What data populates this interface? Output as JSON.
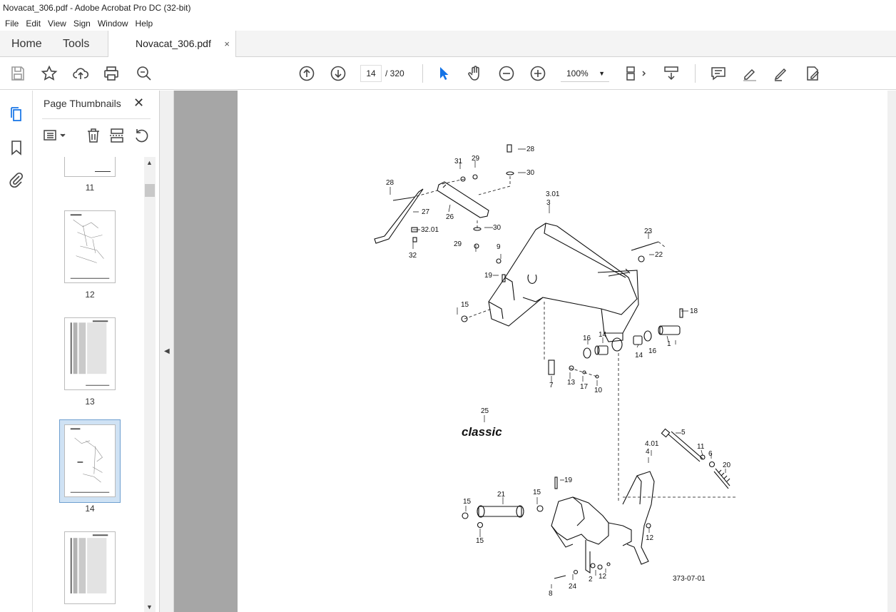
{
  "window": {
    "title": "Novacat_306.pdf - Adobe Acrobat Pro DC (32-bit)"
  },
  "menu": [
    "File",
    "Edit",
    "View",
    "Sign",
    "Window",
    "Help"
  ],
  "tabs": {
    "home": "Home",
    "tools": "Tools",
    "document": "Novacat_306.pdf",
    "close": "×"
  },
  "toolbar": {
    "current_page": "14",
    "page_total": "/ 320",
    "zoom": "100%"
  },
  "panel": {
    "title": "Page Thumbnails",
    "close": "✕",
    "thumbnails": [
      {
        "label": "11"
      },
      {
        "label": "12"
      },
      {
        "label": "13"
      },
      {
        "label": "14",
        "selected": true
      },
      {
        "label": ""
      }
    ]
  },
  "drawing": {
    "brand": "classic",
    "drawing_id": "373-07-01",
    "callouts": [
      "28",
      "31",
      "29",
      "30",
      "3.01",
      "3",
      "28",
      "27",
      "26",
      "32.01",
      "32",
      "30",
      "29",
      "9",
      "19",
      "23",
      "22",
      "15",
      "18",
      "16",
      "14",
      "14",
      "16",
      "1",
      "7",
      "13",
      "17",
      "10",
      "25",
      "5",
      "4.01",
      "4",
      "11",
      "6",
      "20",
      "19",
      "21",
      "15",
      "15",
      "15",
      "12",
      "12",
      "2",
      "24",
      "8"
    ]
  },
  "colors": {
    "accent": "#1473e6",
    "viewer_bg": "#a6a6a6",
    "selected_thumb": "#cfe2f4"
  }
}
